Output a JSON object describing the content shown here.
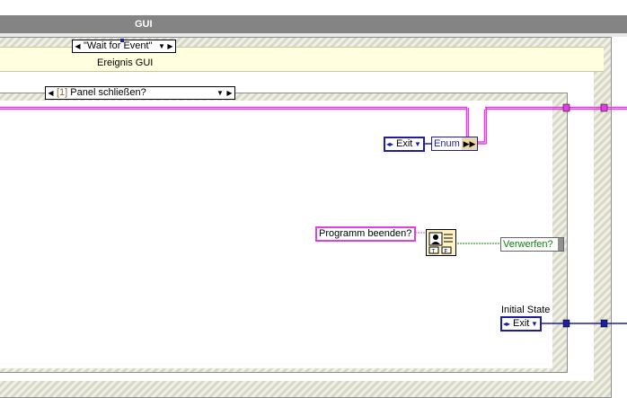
{
  "title_bar": {
    "label": "GUI"
  },
  "event_structure": {
    "selector_label": "\"Wait for Event\"",
    "caption": "Ereignis GUI"
  },
  "case_structure": {
    "index": "[1]",
    "label": "Panel schließen?"
  },
  "constants": {
    "exit_enum": "Exit",
    "unbundle": "Enum",
    "prompt_string": "Programm beenden?",
    "verwerfen_output": "Verwerfen?",
    "initial_state_label": "Initial State",
    "initial_state_value": "Exit"
  },
  "colors": {
    "title_bar": "#848484",
    "event_header": "#ffffe0",
    "string_wire": "#e040e0",
    "enum_wire": "#1e1ea0",
    "bool_wire": "#108010"
  },
  "icons": {
    "dialog": "two-button-dialog-icon",
    "spinner": "enum-spinner-icon",
    "dropdown": "dropdown-arrow-icon"
  }
}
